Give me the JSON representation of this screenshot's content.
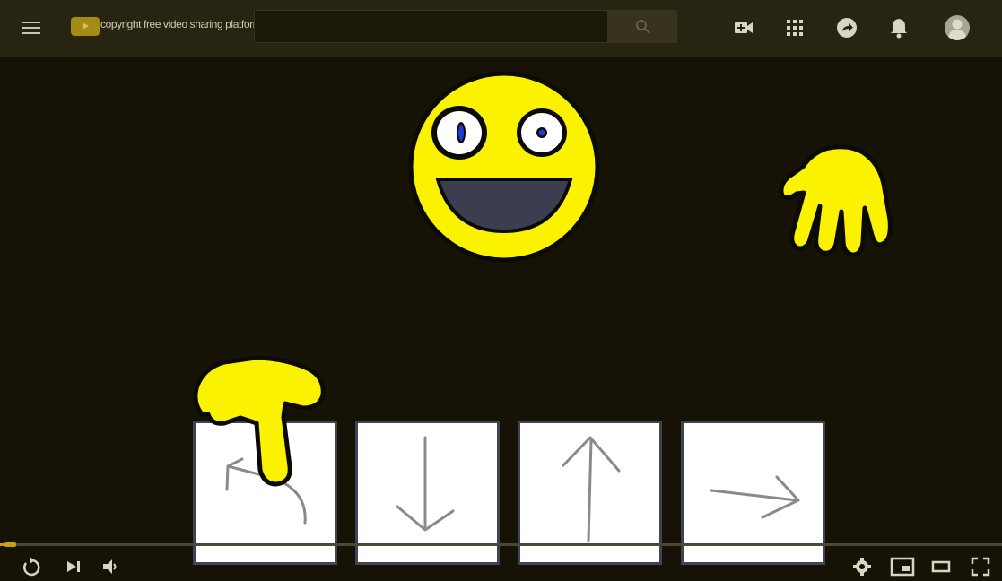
{
  "header": {
    "brand_text": "copyright free video sharing platform",
    "search": {
      "value": "",
      "placeholder": ""
    },
    "icons": [
      "menu-icon",
      "logo-play-icon",
      "search-icon",
      "create-video-icon",
      "apps-grid-icon",
      "share-arrow-icon",
      "notification-bell-icon",
      "account-avatar-icon"
    ]
  },
  "video": {
    "scene": [
      "smiley-face",
      "waving-hand",
      "pointing-hand"
    ],
    "choice_cards": [
      {
        "name": "card-turn-back",
        "icon": "u-turn-arrow-icon"
      },
      {
        "name": "card-down",
        "icon": "arrow-down-icon"
      },
      {
        "name": "card-up",
        "icon": "arrow-up-icon"
      },
      {
        "name": "card-right",
        "icon": "arrow-right-icon"
      }
    ]
  },
  "player": {
    "progress": 0.016,
    "controls_left": [
      "replay-icon",
      "next-icon",
      "volume-icon"
    ],
    "controls_right": [
      "settings-icon",
      "miniplayer-icon",
      "theater-mode-icon",
      "fullscreen-icon"
    ]
  },
  "colors": {
    "topbar": "#272411",
    "background": "#161306",
    "accent": "#c9a20f",
    "emoji_yellow": "#fbf200"
  }
}
